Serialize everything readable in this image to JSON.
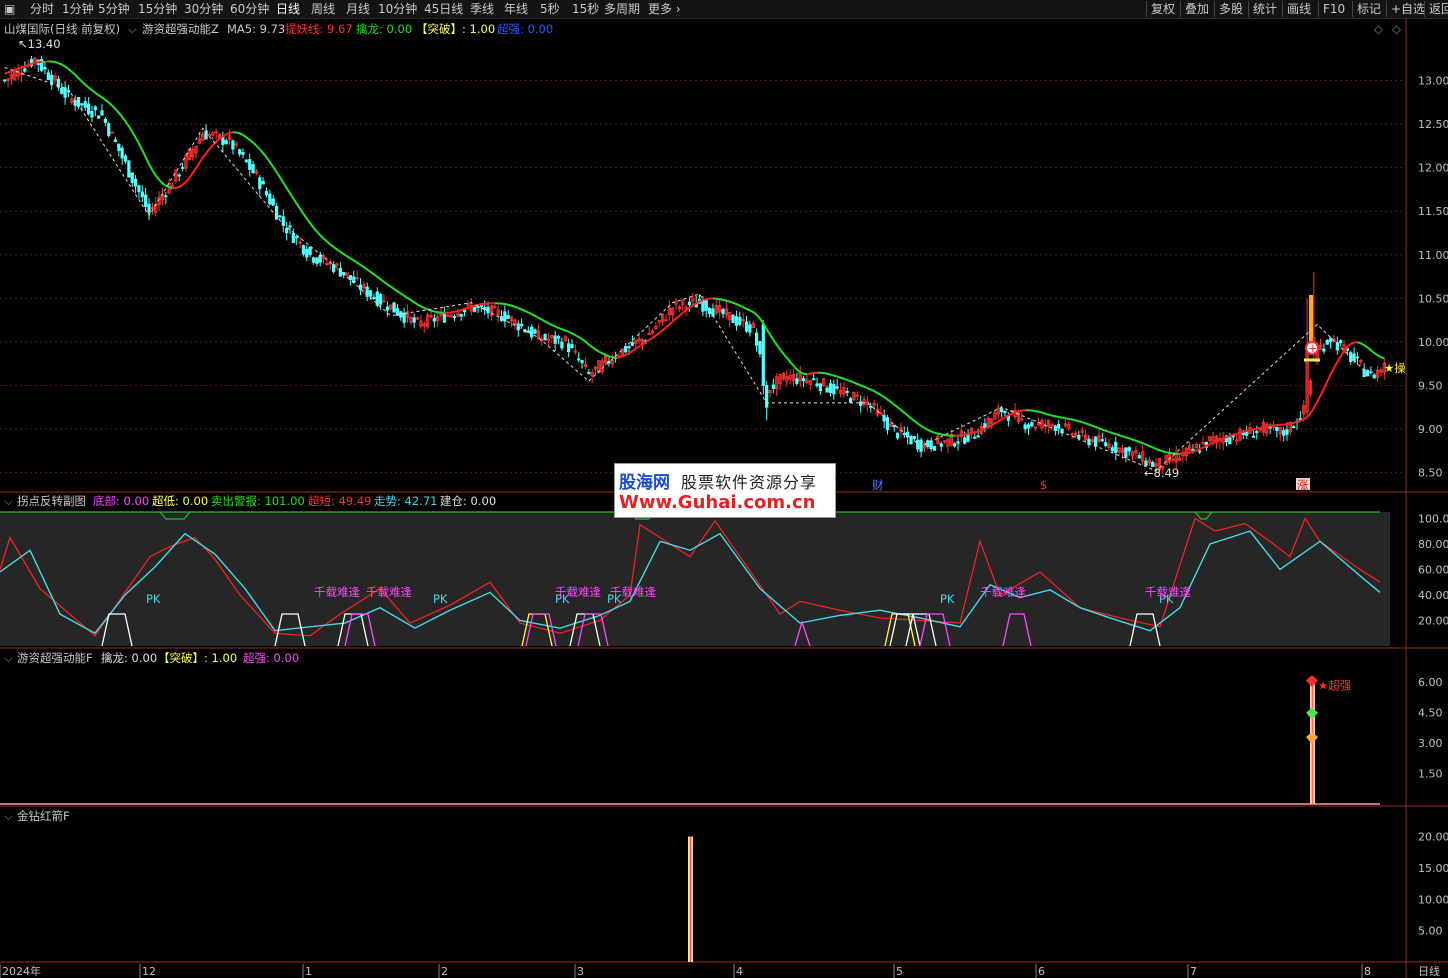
{
  "toolbar": {
    "tabs": [
      "分时",
      "1分钟",
      "5分钟",
      "15分钟",
      "30分钟",
      "60分钟",
      "日线",
      "周线",
      "月线",
      "10分钟",
      "45日线",
      "季线",
      "年线",
      "5秒",
      "15秒",
      "多周期",
      "更多"
    ],
    "active_tab": "日线",
    "right_buttons": [
      "复权",
      "叠加",
      "多股",
      "统计",
      "画线",
      "F10",
      "标记",
      "+自选",
      "返回"
    ]
  },
  "main_panel": {
    "stock": "山煤国际(日线 前复权)",
    "indicator_name": "游资超强动能Z",
    "ma5": "MA5: 9.73",
    "tiyao": "提妖线: 9.67",
    "qinlong": "擒龙: 0.00",
    "tupo": "【突破】: 1.00",
    "chaoqiang": "超强: 0.00",
    "high_label": "13.40",
    "low_label": "8.49",
    "marker_cai": "财",
    "marker_s": "$",
    "marker_zhang": "涨",
    "star_label": "★操",
    "y_ticks": [
      "13.00",
      "12.50",
      "12.00",
      "11.50",
      "11.00",
      "10.50",
      "10.00",
      "9.50",
      "9.00",
      "8.50"
    ]
  },
  "sub_panel_1": {
    "name": "拐点反转副图",
    "dibu": "底部: 0.00",
    "chaodi": "超低: 0.00",
    "maichu": "卖出警报: 101.00",
    "chaoduan": "超短: 49.49",
    "zoushi": "走势: 42.71",
    "jiancang": "建仓: 0.00",
    "annotations": [
      "PK",
      "千载难逢",
      "千载难逢",
      "PK",
      "PK",
      "千载难逢",
      "PK",
      "千载难逢",
      "PK",
      "千载难逢",
      "PK",
      "千载难逢"
    ],
    "y_ticks": [
      "100.00",
      "80.00",
      "60.00",
      "40.00",
      "20.00"
    ]
  },
  "sub_panel_2": {
    "name": "游资超强动能F",
    "qinlong": "擒龙: 0.00",
    "tupo": "【突破】: 1.00",
    "chaoqiang": "超强: 0.00",
    "signal_label": "超强",
    "y_ticks": [
      "6.00",
      "4.50",
      "3.00",
      "1.50"
    ]
  },
  "sub_panel_3": {
    "name": "金钻红箭F",
    "y_ticks": [
      "20.00",
      "15.00",
      "10.00",
      "5.00"
    ]
  },
  "x_axis": {
    "labels": [
      "2024年",
      "12",
      "1",
      "2",
      "3",
      "4",
      "5",
      "6",
      "7",
      "8"
    ],
    "period": "日线"
  },
  "watermark": {
    "brand": "股海网",
    "slogan": "股票软件资源分享",
    "url": "Www.Guhai.com.cn"
  },
  "colors": {
    "up": "#ff3232",
    "down": "#54ffff",
    "ma_green": "#22e022",
    "ma_red": "#ff1e1e",
    "magenta": "#ff44ff",
    "cyan": "#44d8e8",
    "yellow": "#ffff33"
  },
  "chart_data": [
    {
      "type": "candlestick",
      "title": "游资超强动能Z",
      "y_range": [
        8.3,
        13.5
      ],
      "ma_lines": [
        "MA5",
        "提妖线"
      ],
      "ohlc_coarse": [
        {
          "x": 1,
          "close": 13.0
        },
        {
          "x": 10,
          "close": 13.25
        },
        {
          "x": 20,
          "close": 12.8
        },
        {
          "x": 30,
          "close": 12.6
        },
        {
          "x": 40,
          "close": 11.8
        },
        {
          "x": 44,
          "close": 11.48
        },
        {
          "x": 52,
          "close": 11.9
        },
        {
          "x": 60,
          "close": 12.4
        },
        {
          "x": 68,
          "close": 12.3
        },
        {
          "x": 76,
          "close": 11.9
        },
        {
          "x": 84,
          "close": 11.35
        },
        {
          "x": 92,
          "close": 11.0
        },
        {
          "x": 100,
          "close": 10.85
        },
        {
          "x": 108,
          "close": 10.6
        },
        {
          "x": 116,
          "close": 10.4
        },
        {
          "x": 124,
          "close": 10.2
        },
        {
          "x": 132,
          "close": 10.3
        },
        {
          "x": 140,
          "close": 10.4
        },
        {
          "x": 150,
          "close": 10.3
        },
        {
          "x": 160,
          "close": 10.05
        },
        {
          "x": 168,
          "close": 10.0
        },
        {
          "x": 175,
          "close": 9.62
        },
        {
          "x": 184,
          "close": 9.88
        },
        {
          "x": 192,
          "close": 10.05
        },
        {
          "x": 200,
          "close": 10.4
        },
        {
          "x": 208,
          "close": 10.45
        },
        {
          "x": 216,
          "close": 10.3
        },
        {
          "x": 224,
          "close": 10.15
        },
        {
          "x": 228,
          "close": 9.45
        },
        {
          "x": 234,
          "close": 9.6
        },
        {
          "x": 242,
          "close": 9.55
        },
        {
          "x": 250,
          "close": 9.42
        },
        {
          "x": 258,
          "close": 9.3
        },
        {
          "x": 266,
          "close": 8.98
        },
        {
          "x": 274,
          "close": 8.82
        },
        {
          "x": 282,
          "close": 8.85
        },
        {
          "x": 290,
          "close": 8.95
        },
        {
          "x": 298,
          "close": 9.22
        },
        {
          "x": 306,
          "close": 9.05
        },
        {
          "x": 314,
          "close": 9.05
        },
        {
          "x": 322,
          "close": 8.9
        },
        {
          "x": 330,
          "close": 8.82
        },
        {
          "x": 338,
          "close": 8.7
        },
        {
          "x": 344,
          "close": 8.58
        },
        {
          "x": 352,
          "close": 8.7
        },
        {
          "x": 360,
          "close": 8.86
        },
        {
          "x": 368,
          "close": 8.92
        },
        {
          "x": 376,
          "close": 9.0
        },
        {
          "x": 382,
          "close": 8.95
        },
        {
          "x": 388,
          "close": 9.2
        },
        {
          "x": 392,
          "close": 9.9
        },
        {
          "x": 396,
          "close": 10.05
        },
        {
          "x": 400,
          "close": 9.9
        },
        {
          "x": 404,
          "close": 9.75
        },
        {
          "x": 408,
          "close": 9.6
        },
        {
          "x": 412,
          "close": 9.73
        }
      ]
    },
    {
      "type": "line",
      "title": "拐点反转副图",
      "y_range": [
        0,
        105
      ],
      "series": [
        {
          "name": "卖出警报",
          "values": [
            80,
            101,
            101,
            101,
            101
          ]
        },
        {
          "name": "超短",
          "values": [
            49.49
          ]
        },
        {
          "name": "走势",
          "values": [
            42.71
          ]
        }
      ]
    },
    {
      "type": "bar",
      "title": "游资超强动能F",
      "y_range": [
        0,
        6.8
      ],
      "categories": [
        "2024-08"
      ],
      "values": [
        6.0
      ]
    },
    {
      "type": "bar",
      "title": "金钻红箭F",
      "y_range": [
        0,
        22
      ],
      "categories": [
        "2024-03"
      ],
      "values": [
        20.0
      ]
    }
  ]
}
